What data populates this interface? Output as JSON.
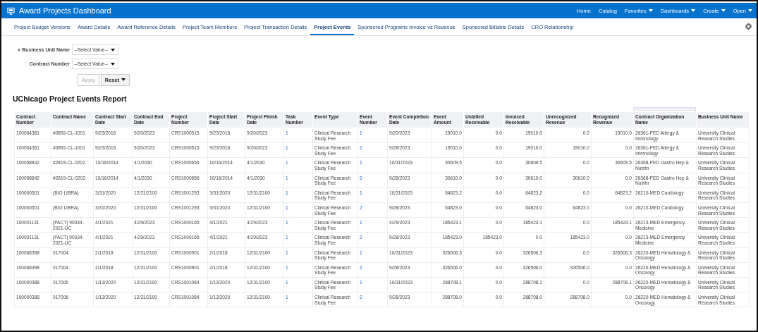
{
  "header": {
    "title": "Award Projects Dashboard",
    "menu": [
      {
        "label": "Home",
        "has_menu": false
      },
      {
        "label": "Catalog",
        "has_menu": false
      },
      {
        "label": "Favorites",
        "has_menu": true
      },
      {
        "label": "Dashboards",
        "has_menu": true
      },
      {
        "label": "Create",
        "has_menu": true
      },
      {
        "label": "Open",
        "has_menu": true
      }
    ]
  },
  "tabs": [
    {
      "label": "Project Budget Versions",
      "selected": false
    },
    {
      "label": "Award Details",
      "selected": false
    },
    {
      "label": "Award Reference Details",
      "selected": false
    },
    {
      "label": "Project Team Members",
      "selected": false
    },
    {
      "label": "Project Transaction Details",
      "selected": false
    },
    {
      "label": "Project Events",
      "selected": true
    },
    {
      "label": "Sponsored Programs Invoice vs Revenue",
      "selected": false
    },
    {
      "label": "Sponsored Billable Details",
      "selected": false
    },
    {
      "label": "CRO Relationship",
      "selected": false
    }
  ],
  "filters": [
    {
      "label": "Business Unit Name",
      "required": true,
      "placeholder": "--Select Value--"
    },
    {
      "label": "Contract Number",
      "required": false,
      "placeholder": "--Select Value--"
    }
  ],
  "buttons": [
    {
      "label": "Apply",
      "disabled": true,
      "has_menu": false
    },
    {
      "label": "Reset",
      "disabled": false,
      "has_menu": true
    }
  ],
  "report": {
    "title": "UChicago Project Events Report",
    "columns": [
      {
        "label": "Contract Number",
        "kind": "text"
      },
      {
        "label": "Contract Name",
        "kind": "text"
      },
      {
        "label": "Contract Start Date",
        "kind": "text"
      },
      {
        "label": "Contract End Date",
        "kind": "text"
      },
      {
        "label": "Project Number",
        "kind": "text"
      },
      {
        "label": "Project Start Date",
        "kind": "text"
      },
      {
        "label": "Project Finish Date",
        "kind": "text"
      },
      {
        "label": "Task Number",
        "kind": "link"
      },
      {
        "label": "Event Type",
        "kind": "text"
      },
      {
        "label": "Event Number",
        "kind": "link"
      },
      {
        "label": "Event Completion Date",
        "kind": "text"
      },
      {
        "label": "Event Amount",
        "kind": "number"
      },
      {
        "label": "Unbilled Receivable",
        "kind": "number"
      },
      {
        "label": "Invoiced Receivable",
        "kind": "number"
      },
      {
        "label": "Unrecognized Revenue",
        "kind": "number"
      },
      {
        "label": "Recognized Revenue",
        "kind": "number"
      },
      {
        "label": "Contract Organization Name",
        "kind": "text"
      },
      {
        "label": "Business Unit Name",
        "kind": "text"
      }
    ],
    "rows": [
      [
        "100064361",
        "#0892-CL-1001",
        "9/23/2016",
        "9/20/2023",
        "CRS1000515",
        "9/23/2016",
        "9/20/2023",
        "1",
        "Clinical Research Study Fee",
        "1",
        "9/20/2023",
        "19010.0",
        "0.0",
        "19010.0",
        "0.0",
        "19010.0",
        "26361-PED Allergy & Immnology",
        "University Clinical Research Studies"
      ],
      [
        "100064361",
        "#0892-CL-1001",
        "9/23/2016",
        "9/20/2023",
        "CRS1000515",
        "9/23/2016",
        "9/20/2023",
        "1",
        "Clinical Research Study Fee",
        "2",
        "9/28/2023",
        "19010.0",
        "0.0",
        "19010.0",
        "19010.0",
        "0.0",
        "26361-PED Allergy & Immnology",
        "University Clinical Research Studies"
      ],
      [
        "100058842",
        "#2819-CL-0202",
        "10/16/2014",
        "4/1/2030",
        "CRS1000656",
        "10/16/2014",
        "4/1/2030",
        "1",
        "Clinical Research Study Fee",
        "1",
        "10/31/2023",
        "30609.5",
        "0.0",
        "30609.5",
        "0.0",
        "30609.5",
        "26368-PED Gastro Hep & Nutritn",
        "University Clinical Research Studies"
      ],
      [
        "100058842",
        "#2819-CL-0202",
        "10/16/2014",
        "4/1/2030",
        "CRS1000656",
        "10/16/2014",
        "4/1/2030",
        "1",
        "Clinical Research Study Fee",
        "2",
        "9/28/2023",
        "30610.0",
        "0.0",
        "30610.0",
        "30610.0",
        "0.0",
        "26368-PED Gastro Hep & Nutritn",
        "University Clinical Research Studies"
      ],
      [
        "100000501",
        "(BIO LIBRA)",
        "3/31/2020",
        "12/31/2100",
        "CRS1001293",
        "3/31/2020",
        "12/31/2100",
        "1",
        "Clinical Research Study Fee",
        "1",
        "10/31/2023",
        "64823.2",
        "0.0",
        "64823.2",
        "0.0",
        "64823.2",
        "26210-MED Cardiology",
        "University Clinical Research Studies"
      ],
      [
        "100000501",
        "(BIO LIBRA)",
        "3/31/2020",
        "12/31/2100",
        "CRS1001293",
        "3/31/2020",
        "12/31/2100",
        "1",
        "Clinical Research Study Fee",
        "2",
        "9/28/2023",
        "64823.0",
        "0.0",
        "64823.0",
        "64823.0",
        "0.0",
        "26210-MED Cardiology",
        "University Clinical Research Studies"
      ],
      [
        "100001131",
        "(PACT) 90034-2021-UC",
        "4/1/2021",
        "4/29/2023",
        "CRS1000165",
        "4/1/2021",
        "4/29/2023",
        "1",
        "Clinical Research Study Fee",
        "1",
        "4/29/2023",
        "185423.1",
        "0.0",
        "185423.1",
        "0.0",
        "185423.1",
        "26213-MED Emergency Medicine",
        "University Clinical Research Studies"
      ],
      [
        "100001131",
        "(PACT) 90034-2021-UC",
        "4/1/2021",
        "4/29/2023",
        "CRS1000165",
        "4/1/2021",
        "4/29/2023",
        "1",
        "Clinical Research Study Fee",
        "2",
        "9/28/2023",
        "185423.0",
        "185423.0",
        "0.0",
        "185423.0",
        "0.0",
        "26213-MED Emergency Medicine",
        "University Clinical Research Studies"
      ],
      [
        "100068398",
        "017004",
        "2/1/2018",
        "12/31/2100",
        "CRS1000901",
        "2/1/2018",
        "12/31/2100",
        "1",
        "Clinical Research Study Fee",
        "1",
        "10/31/2023",
        "326506.3",
        "0.0",
        "326506.3",
        "0.0",
        "326506.3",
        "26220-MED Hematology & Oncology",
        "University Clinical Research Studies"
      ],
      [
        "100068398",
        "017004",
        "2/1/2018",
        "12/31/2100",
        "CRS1000901",
        "2/1/2018",
        "12/31/2100",
        "1",
        "Clinical Research Study Fee",
        "2",
        "9/28/2023",
        "326506.0",
        "0.0",
        "326506.0",
        "326506.0",
        "0.0",
        "26220-MED Hematology & Oncology",
        "University Clinical Research Studies"
      ],
      [
        "100000388",
        "017006",
        "1/13/2020",
        "12/31/2100",
        "CRS1001084",
        "1/13/2020",
        "12/31/2100",
        "1",
        "Clinical Research Study Fee",
        "1",
        "10/31/2023",
        "288708.1",
        "0.0",
        "288708.1",
        "0.0",
        "288708.1",
        "26220-MED Hematology & Oncology",
        "University Clinical Research Studies"
      ],
      [
        "100000388",
        "017006",
        "1/13/2020",
        "12/31/2100",
        "CRS1001084",
        "1/13/2020",
        "12/31/2100",
        "1",
        "Clinical Research Study Fee",
        "2",
        "9/28/2023",
        "288708.0",
        "0.0",
        "288708.0",
        "288708.0",
        "0.0",
        "26220-MED Hematology & Oncology",
        "University Clinical Research Studies"
      ]
    ]
  }
}
